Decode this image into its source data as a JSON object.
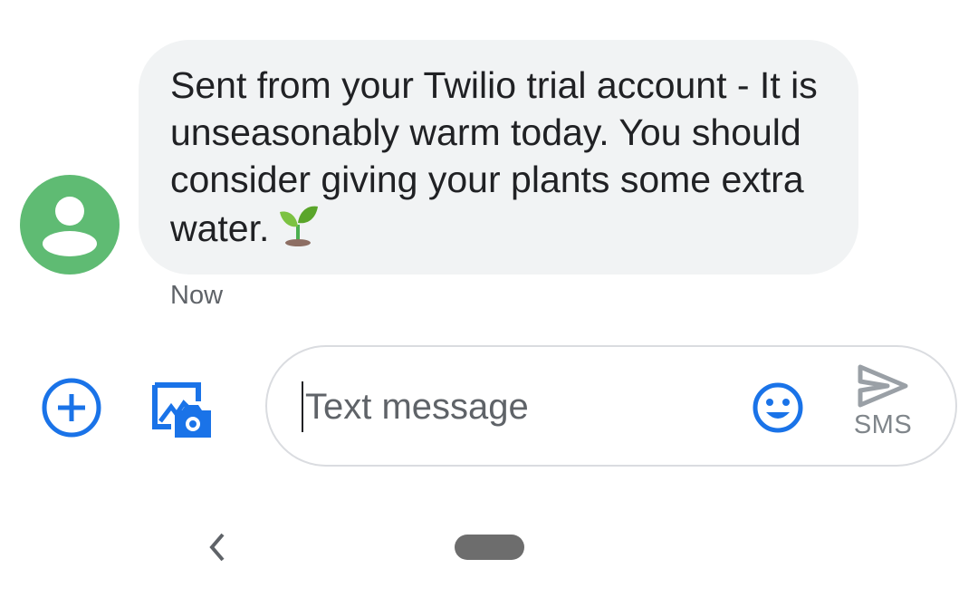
{
  "conversation": {
    "messages": [
      {
        "direction": "incoming",
        "text": "Sent from your Twilio trial account - It is unseasonably warm today. You should consider giving your plants some extra water.",
        "emoji": "seedling",
        "timestamp": "Now"
      }
    ],
    "avatar_icon": "person-icon"
  },
  "composer": {
    "placeholder": "Text message",
    "value": "",
    "send_mode_label": "SMS",
    "icons": [
      "plus-circle-icon",
      "gallery-camera-icon",
      "emoji-icon",
      "send-icon"
    ]
  },
  "navigation": {
    "icons": [
      "back-icon",
      "home-pill-icon"
    ]
  },
  "colors": {
    "accent": "#1a73e8",
    "avatar": "#5fbb73",
    "bubble": "#f1f3f4",
    "text": "#202124",
    "secondary_text": "#5f6368",
    "send_disabled": "#9aa0a6"
  }
}
